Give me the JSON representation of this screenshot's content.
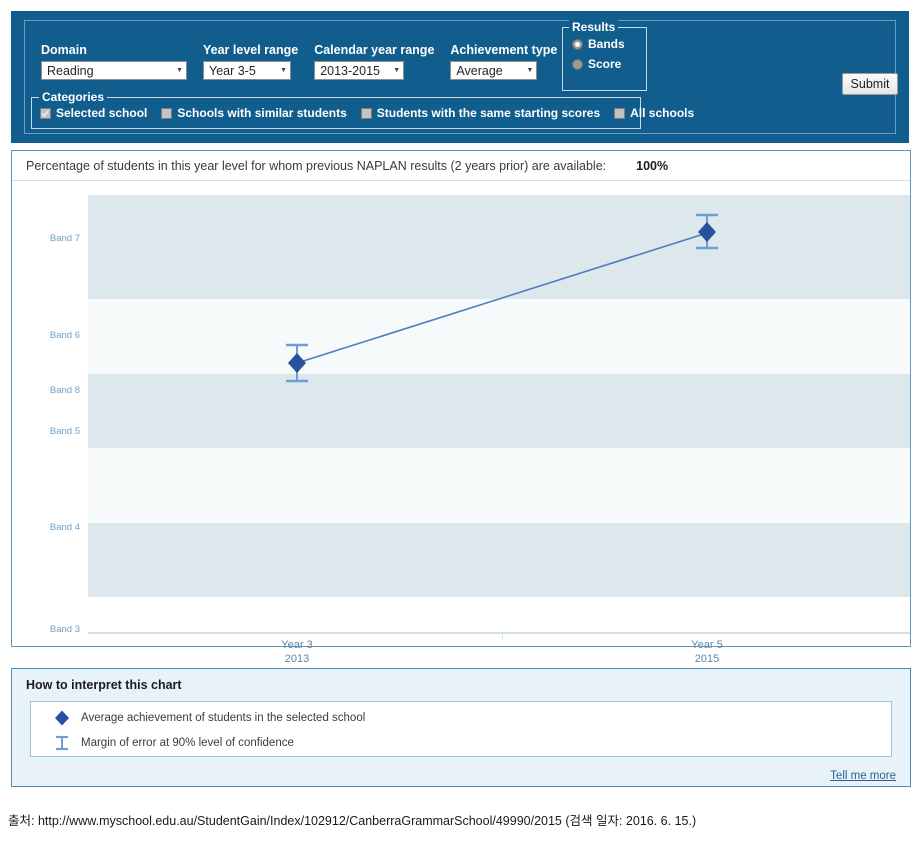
{
  "controls": {
    "domain": {
      "label": "Domain",
      "value": "Reading"
    },
    "year_level_range": {
      "label": "Year level range",
      "value": "Year 3-5"
    },
    "calendar_year_range": {
      "label": "Calendar year range",
      "value": "2013-2015"
    },
    "achievement_type": {
      "label": "Achievement type",
      "value": "Average"
    },
    "results": {
      "legend": "Results",
      "options": [
        {
          "label": "Bands",
          "selected": true
        },
        {
          "label": "Score",
          "selected": false
        }
      ]
    },
    "categories": {
      "legend": "Categories",
      "options": [
        {
          "label": "Selected school",
          "checked": true
        },
        {
          "label": "Schools with similar students",
          "checked": false
        },
        {
          "label": "Students with the same starting scores",
          "checked": false
        },
        {
          "label": "All schools",
          "checked": false
        }
      ]
    },
    "submit_label": "Submit"
  },
  "availability": {
    "text": "Percentage of students in this year level for whom previous NAPLAN results (2 years prior) are available:",
    "value": "100%"
  },
  "chart_data": {
    "type": "line",
    "title": "",
    "xlabel": "",
    "ylabel": "",
    "categories": [
      "Year 3\n2013",
      "Year 5\n2015"
    ],
    "x_tick_labels": [
      {
        "line1": "Year 3",
        "line2": "2013"
      },
      {
        "line1": "Year 5",
        "line2": "2015"
      }
    ],
    "y_tick_labels": [
      "Band 8",
      "Band 7",
      "Band 6",
      "Band 5",
      "Band 4",
      "Band 3"
    ],
    "ylim": [
      3,
      8.4
    ],
    "grid": false,
    "legend_position": "below-chart",
    "series": [
      {
        "name": "Average achievement of students in the selected school",
        "color": "#27539e",
        "line_color": "#4a7ec0",
        "x": [
          "Year 3 2013",
          "Year 5 2015"
        ],
        "values": [
          5.93,
          7.62
        ],
        "error_low": [
          5.72,
          7.44
        ],
        "error_high": [
          6.15,
          7.82
        ]
      }
    ],
    "band_shading": [
      {
        "from": 7.0,
        "to": 8.4,
        "shaded": true
      },
      {
        "from": 6.0,
        "to": 7.0,
        "shaded": false
      },
      {
        "from": 5.0,
        "to": 6.0,
        "shaded": true
      },
      {
        "from": 4.0,
        "to": 5.0,
        "shaded": false
      },
      {
        "from": 3.0,
        "to": 4.0,
        "shaded": true
      }
    ]
  },
  "interpret": {
    "title": "How to interpret this chart",
    "items": [
      {
        "glyph": "diamond",
        "text": "Average achievement of students in the selected school"
      },
      {
        "glyph": "error-bar",
        "text": "Margin of error at 90% level of confidence"
      }
    ],
    "tell_me_more": "Tell me more"
  },
  "source": {
    "text": "출처: http://www.myschool.edu.au/StudentGain/Index/102912/CanberraGrammarSchool/49990/2015 (검색 일자: 2016. 6. 15.)"
  },
  "colors": {
    "panel_blue": "#115d8e",
    "marker_blue": "#27539e",
    "line_blue": "#4a7ec0",
    "band_shade": "#dde8ed",
    "plot_bg": "#f6fafb"
  }
}
